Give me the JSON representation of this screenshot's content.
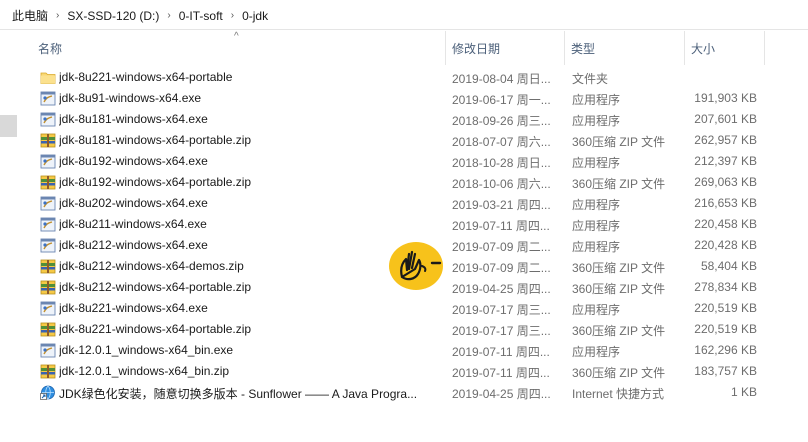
{
  "breadcrumb": [
    "此电脑",
    "SX-SSD-120 (D:)",
    "0-IT-soft",
    "0-jdk"
  ],
  "columns": {
    "name": "名称",
    "date": "修改日期",
    "type": "类型",
    "size": "大小"
  },
  "files": [
    {
      "name": "jdk-8u221-windows-x64-portable",
      "date": "2019-08-04 周日...",
      "type": "文件夹",
      "size": "",
      "icon": "folder-icon"
    },
    {
      "name": "jdk-8u91-windows-x64.exe",
      "date": "2019-06-17 周一...",
      "type": "应用程序",
      "size": "191,903 KB",
      "icon": "exe-icon"
    },
    {
      "name": "jdk-8u181-windows-x64.exe",
      "date": "2018-09-26 周三...",
      "type": "应用程序",
      "size": "207,601 KB",
      "icon": "exe-icon"
    },
    {
      "name": "jdk-8u181-windows-x64-portable.zip",
      "date": "2018-07-07 周六...",
      "type": "360压缩 ZIP 文件",
      "size": "262,957 KB",
      "icon": "zip-icon"
    },
    {
      "name": "jdk-8u192-windows-x64.exe",
      "date": "2018-10-28 周日...",
      "type": "应用程序",
      "size": "212,397 KB",
      "icon": "exe-icon"
    },
    {
      "name": "jdk-8u192-windows-x64-portable.zip",
      "date": "2018-10-06 周六...",
      "type": "360压缩 ZIP 文件",
      "size": "269,063 KB",
      "icon": "zip-icon"
    },
    {
      "name": "jdk-8u202-windows-x64.exe",
      "date": "2019-03-21 周四...",
      "type": "应用程序",
      "size": "216,653 KB",
      "icon": "exe-icon"
    },
    {
      "name": "jdk-8u211-windows-x64.exe",
      "date": "2019-07-11 周四...",
      "type": "应用程序",
      "size": "220,458 KB",
      "icon": "exe-icon"
    },
    {
      "name": "jdk-8u212-windows-x64.exe",
      "date": "2019-07-09 周二...",
      "type": "应用程序",
      "size": "220,428 KB",
      "icon": "exe-icon"
    },
    {
      "name": "jdk-8u212-windows-x64-demos.zip",
      "date": "2019-07-09 周二...",
      "type": "360压缩 ZIP 文件",
      "size": "58,404 KB",
      "icon": "zip-icon"
    },
    {
      "name": "jdk-8u212-windows-x64-portable.zip",
      "date": "2019-04-25 周四...",
      "type": "360压缩 ZIP 文件",
      "size": "278,834 KB",
      "icon": "zip-icon"
    },
    {
      "name": "jdk-8u221-windows-x64.exe",
      "date": "2019-07-17 周三...",
      "type": "应用程序",
      "size": "220,519 KB",
      "icon": "exe-icon"
    },
    {
      "name": "jdk-8u221-windows-x64-portable.zip",
      "date": "2019-07-17 周三...",
      "type": "360压缩 ZIP 文件",
      "size": "220,519 KB",
      "icon": "zip-icon"
    },
    {
      "name": "jdk-12.0.1_windows-x64_bin.exe",
      "date": "2019-07-11 周四...",
      "type": "应用程序",
      "size": "162,296 KB",
      "icon": "exe-icon"
    },
    {
      "name": "jdk-12.0.1_windows-x64_bin.zip",
      "date": "2019-07-11 周四...",
      "type": "360压缩 ZIP 文件",
      "size": "183,757 KB",
      "icon": "zip-icon"
    },
    {
      "name": "JDK绿色化安装，随意切换多版本 - Sunflower —— A Java Progra...",
      "date": "2019-04-25 周四...",
      "type": "Internet 快捷方式",
      "size": "1 KB",
      "icon": "internet-shortcut-icon"
    }
  ],
  "overlay": {
    "icon": "waving-hand-emoji-icon",
    "color": "#f7c21b"
  }
}
